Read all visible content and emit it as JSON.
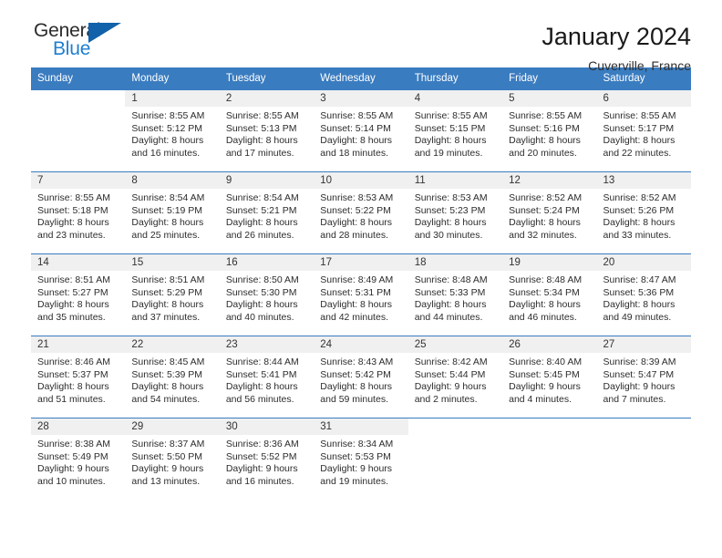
{
  "brand": {
    "name_top": "General",
    "name_bottom": "Blue",
    "triangle_color": "#1162ab",
    "blue_color": "#1f7fd0"
  },
  "header": {
    "month_year": "January 2024",
    "location": "Cuverville, France"
  },
  "theme": {
    "header_bar": "#3a7cc0",
    "day_band": "#f0f0f0",
    "grid_line": "#3a7cc0"
  },
  "weekdays": [
    "Sunday",
    "Monday",
    "Tuesday",
    "Wednesday",
    "Thursday",
    "Friday",
    "Saturday"
  ],
  "weeks": [
    [
      {
        "day": "",
        "blank": true,
        "sunrise": "",
        "sunset": "",
        "daylight1": "",
        "daylight2": ""
      },
      {
        "day": "1",
        "sunrise": "Sunrise: 8:55 AM",
        "sunset": "Sunset: 5:12 PM",
        "daylight1": "Daylight: 8 hours",
        "daylight2": "and 16 minutes."
      },
      {
        "day": "2",
        "sunrise": "Sunrise: 8:55 AM",
        "sunset": "Sunset: 5:13 PM",
        "daylight1": "Daylight: 8 hours",
        "daylight2": "and 17 minutes."
      },
      {
        "day": "3",
        "sunrise": "Sunrise: 8:55 AM",
        "sunset": "Sunset: 5:14 PM",
        "daylight1": "Daylight: 8 hours",
        "daylight2": "and 18 minutes."
      },
      {
        "day": "4",
        "sunrise": "Sunrise: 8:55 AM",
        "sunset": "Sunset: 5:15 PM",
        "daylight1": "Daylight: 8 hours",
        "daylight2": "and 19 minutes."
      },
      {
        "day": "5",
        "sunrise": "Sunrise: 8:55 AM",
        "sunset": "Sunset: 5:16 PM",
        "daylight1": "Daylight: 8 hours",
        "daylight2": "and 20 minutes."
      },
      {
        "day": "6",
        "sunrise": "Sunrise: 8:55 AM",
        "sunset": "Sunset: 5:17 PM",
        "daylight1": "Daylight: 8 hours",
        "daylight2": "and 22 minutes."
      }
    ],
    [
      {
        "day": "7",
        "sunrise": "Sunrise: 8:55 AM",
        "sunset": "Sunset: 5:18 PM",
        "daylight1": "Daylight: 8 hours",
        "daylight2": "and 23 minutes."
      },
      {
        "day": "8",
        "sunrise": "Sunrise: 8:54 AM",
        "sunset": "Sunset: 5:19 PM",
        "daylight1": "Daylight: 8 hours",
        "daylight2": "and 25 minutes."
      },
      {
        "day": "9",
        "sunrise": "Sunrise: 8:54 AM",
        "sunset": "Sunset: 5:21 PM",
        "daylight1": "Daylight: 8 hours",
        "daylight2": "and 26 minutes."
      },
      {
        "day": "10",
        "sunrise": "Sunrise: 8:53 AM",
        "sunset": "Sunset: 5:22 PM",
        "daylight1": "Daylight: 8 hours",
        "daylight2": "and 28 minutes."
      },
      {
        "day": "11",
        "sunrise": "Sunrise: 8:53 AM",
        "sunset": "Sunset: 5:23 PM",
        "daylight1": "Daylight: 8 hours",
        "daylight2": "and 30 minutes."
      },
      {
        "day": "12",
        "sunrise": "Sunrise: 8:52 AM",
        "sunset": "Sunset: 5:24 PM",
        "daylight1": "Daylight: 8 hours",
        "daylight2": "and 32 minutes."
      },
      {
        "day": "13",
        "sunrise": "Sunrise: 8:52 AM",
        "sunset": "Sunset: 5:26 PM",
        "daylight1": "Daylight: 8 hours",
        "daylight2": "and 33 minutes."
      }
    ],
    [
      {
        "day": "14",
        "sunrise": "Sunrise: 8:51 AM",
        "sunset": "Sunset: 5:27 PM",
        "daylight1": "Daylight: 8 hours",
        "daylight2": "and 35 minutes."
      },
      {
        "day": "15",
        "sunrise": "Sunrise: 8:51 AM",
        "sunset": "Sunset: 5:29 PM",
        "daylight1": "Daylight: 8 hours",
        "daylight2": "and 37 minutes."
      },
      {
        "day": "16",
        "sunrise": "Sunrise: 8:50 AM",
        "sunset": "Sunset: 5:30 PM",
        "daylight1": "Daylight: 8 hours",
        "daylight2": "and 40 minutes."
      },
      {
        "day": "17",
        "sunrise": "Sunrise: 8:49 AM",
        "sunset": "Sunset: 5:31 PM",
        "daylight1": "Daylight: 8 hours",
        "daylight2": "and 42 minutes."
      },
      {
        "day": "18",
        "sunrise": "Sunrise: 8:48 AM",
        "sunset": "Sunset: 5:33 PM",
        "daylight1": "Daylight: 8 hours",
        "daylight2": "and 44 minutes."
      },
      {
        "day": "19",
        "sunrise": "Sunrise: 8:48 AM",
        "sunset": "Sunset: 5:34 PM",
        "daylight1": "Daylight: 8 hours",
        "daylight2": "and 46 minutes."
      },
      {
        "day": "20",
        "sunrise": "Sunrise: 8:47 AM",
        "sunset": "Sunset: 5:36 PM",
        "daylight1": "Daylight: 8 hours",
        "daylight2": "and 49 minutes."
      }
    ],
    [
      {
        "day": "21",
        "sunrise": "Sunrise: 8:46 AM",
        "sunset": "Sunset: 5:37 PM",
        "daylight1": "Daylight: 8 hours",
        "daylight2": "and 51 minutes."
      },
      {
        "day": "22",
        "sunrise": "Sunrise: 8:45 AM",
        "sunset": "Sunset: 5:39 PM",
        "daylight1": "Daylight: 8 hours",
        "daylight2": "and 54 minutes."
      },
      {
        "day": "23",
        "sunrise": "Sunrise: 8:44 AM",
        "sunset": "Sunset: 5:41 PM",
        "daylight1": "Daylight: 8 hours",
        "daylight2": "and 56 minutes."
      },
      {
        "day": "24",
        "sunrise": "Sunrise: 8:43 AM",
        "sunset": "Sunset: 5:42 PM",
        "daylight1": "Daylight: 8 hours",
        "daylight2": "and 59 minutes."
      },
      {
        "day": "25",
        "sunrise": "Sunrise: 8:42 AM",
        "sunset": "Sunset: 5:44 PM",
        "daylight1": "Daylight: 9 hours",
        "daylight2": "and 2 minutes."
      },
      {
        "day": "26",
        "sunrise": "Sunrise: 8:40 AM",
        "sunset": "Sunset: 5:45 PM",
        "daylight1": "Daylight: 9 hours",
        "daylight2": "and 4 minutes."
      },
      {
        "day": "27",
        "sunrise": "Sunrise: 8:39 AM",
        "sunset": "Sunset: 5:47 PM",
        "daylight1": "Daylight: 9 hours",
        "daylight2": "and 7 minutes."
      }
    ],
    [
      {
        "day": "28",
        "sunrise": "Sunrise: 8:38 AM",
        "sunset": "Sunset: 5:49 PM",
        "daylight1": "Daylight: 9 hours",
        "daylight2": "and 10 minutes."
      },
      {
        "day": "29",
        "sunrise": "Sunrise: 8:37 AM",
        "sunset": "Sunset: 5:50 PM",
        "daylight1": "Daylight: 9 hours",
        "daylight2": "and 13 minutes."
      },
      {
        "day": "30",
        "sunrise": "Sunrise: 8:36 AM",
        "sunset": "Sunset: 5:52 PM",
        "daylight1": "Daylight: 9 hours",
        "daylight2": "and 16 minutes."
      },
      {
        "day": "31",
        "sunrise": "Sunrise: 8:34 AM",
        "sunset": "Sunset: 5:53 PM",
        "daylight1": "Daylight: 9 hours",
        "daylight2": "and 19 minutes."
      },
      {
        "day": "",
        "blank": true,
        "sunrise": "",
        "sunset": "",
        "daylight1": "",
        "daylight2": ""
      },
      {
        "day": "",
        "blank": true,
        "sunrise": "",
        "sunset": "",
        "daylight1": "",
        "daylight2": ""
      },
      {
        "day": "",
        "blank": true,
        "sunrise": "",
        "sunset": "",
        "daylight1": "",
        "daylight2": ""
      }
    ]
  ]
}
